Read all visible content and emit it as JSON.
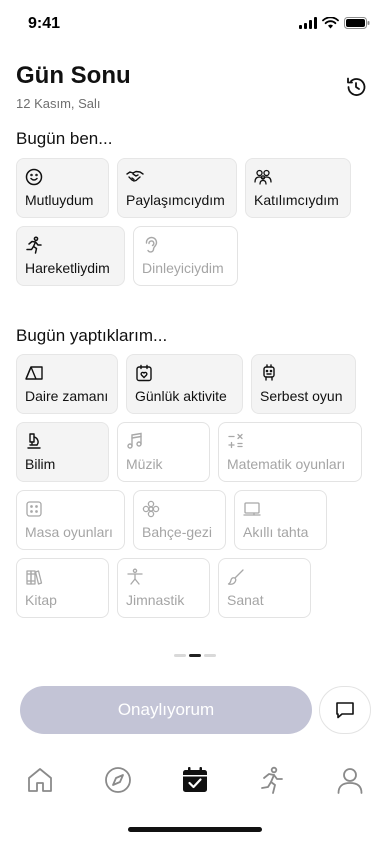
{
  "status": {
    "time": "9:41"
  },
  "header": {
    "title": "Gün Sonu",
    "date": "12 Kasım, Salı",
    "history_icon": "history-icon"
  },
  "feelings": {
    "title": "Bugün ben...",
    "items": [
      {
        "label": "Mutluydum",
        "icon": "smile-icon",
        "active": true
      },
      {
        "label": "Paylaşımcıydım",
        "icon": "handshake-icon",
        "active": true
      },
      {
        "label": "Katılımcıydım",
        "icon": "group-icon",
        "active": true
      },
      {
        "label": "Hareketliydim",
        "icon": "running-icon",
        "active": true
      },
      {
        "label": "Dinleyiciydim",
        "icon": "ear-icon",
        "active": false
      }
    ]
  },
  "activities": {
    "title": "Bugün yaptıklarım...",
    "items": [
      {
        "label": "Daire zamanı",
        "icon": "tent-icon",
        "active": true
      },
      {
        "label": "Günlük aktivite",
        "icon": "calendar-heart-icon",
        "active": true
      },
      {
        "label": "Serbest oyun",
        "icon": "robot-icon",
        "active": true
      },
      {
        "label": "Bilim",
        "icon": "microscope-icon",
        "active": true
      },
      {
        "label": "Müzik",
        "icon": "music-icon",
        "active": false
      },
      {
        "label": "Matematik oyunları",
        "icon": "math-icon",
        "active": false
      },
      {
        "label": "Masa oyunları",
        "icon": "dice-icon",
        "active": false
      },
      {
        "label": "Bahçe-gezi",
        "icon": "flower-icon",
        "active": false
      },
      {
        "label": "Akıllı tahta",
        "icon": "board-icon",
        "active": false
      },
      {
        "label": "Kitap",
        "icon": "books-icon",
        "active": false
      },
      {
        "label": "Jimnastik",
        "icon": "gymnastics-icon",
        "active": false
      },
      {
        "label": "Sanat",
        "icon": "brush-icon",
        "active": false
      }
    ]
  },
  "pager": {
    "pages": 3,
    "current": 2
  },
  "actions": {
    "confirm_label": "Onaylıyorum",
    "chat_icon": "chat-icon"
  },
  "tabbar": {
    "items": [
      {
        "icon": "home-icon",
        "active": false
      },
      {
        "icon": "compass-icon",
        "active": false
      },
      {
        "icon": "calendar-check-icon",
        "active": true
      },
      {
        "icon": "activity-icon",
        "active": false
      },
      {
        "icon": "profile-icon",
        "active": false
      }
    ]
  },
  "colors": {
    "confirm_bg": "#c3c4d6",
    "active_text": "#111111",
    "inactive_text": "#a5a5a5",
    "chip_active_bg": "#f4f4f4"
  }
}
